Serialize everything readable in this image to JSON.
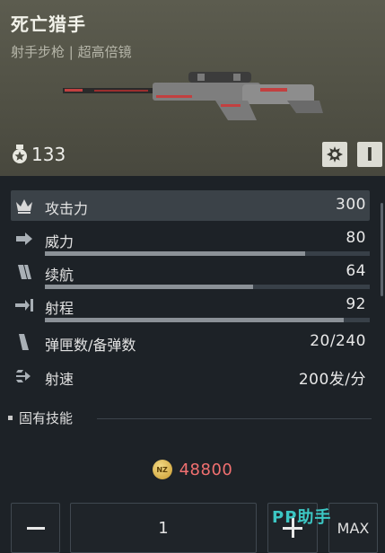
{
  "weapon": {
    "name": "死亡猎手",
    "subtitle": "射手步枪 | 超高倍镜",
    "score": "133"
  },
  "header_buttons": {
    "level_label": "I",
    "attach_icon": "gear-cog-icon"
  },
  "stats": [
    {
      "label": "攻击力",
      "value": "300",
      "icon": "crown-icon",
      "bar": null
    },
    {
      "label": "威力",
      "value": "80",
      "icon": "arrow-right-icon",
      "bar": 0.8
    },
    {
      "label": "续航",
      "value": "64",
      "icon": "magazine-icon",
      "bar": 0.64
    },
    {
      "label": "射程",
      "value": "92",
      "icon": "range-arrow-icon",
      "bar": 0.92
    },
    {
      "label": "弹匣数/备弹数",
      "value": "20/240",
      "icon": "ammo-icon",
      "bar": null
    },
    {
      "label": "射速",
      "value": "200发/分",
      "icon": "fire-rate-icon",
      "bar": null
    }
  ],
  "skills": {
    "label": "固有技能"
  },
  "price": {
    "currency_icon": "nz-coin-icon",
    "coin_text": "NZ",
    "value": "48800"
  },
  "quantity": {
    "value": "1",
    "max_label": "MAX"
  },
  "watermark": "PP助手",
  "colors": {
    "price": "#f07070",
    "accent": "#3cc7c4",
    "header_bg": "#55554a",
    "panel_bg": "#1d2227"
  }
}
